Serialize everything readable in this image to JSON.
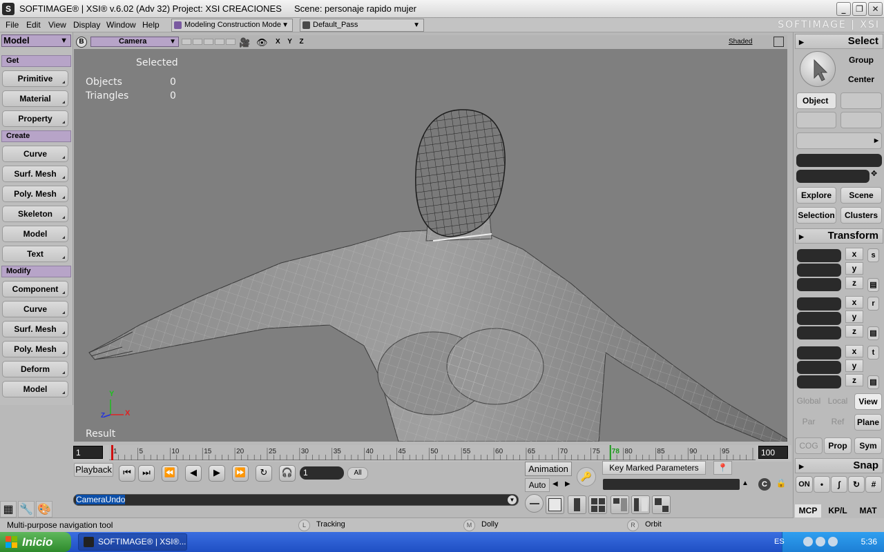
{
  "titlebar": {
    "icon": "S",
    "title": "SOFTIMAGE® | XSI® v.6.02 (Adv 32) Project: XSI CREACIONES     Scene: personaje rapido mujer",
    "minimize": "_",
    "maximize": "❐",
    "close": "✕"
  },
  "menubar": {
    "items": [
      "File",
      "Edit",
      "View",
      "Display",
      "Window",
      "Help"
    ],
    "mode_combo": "Modeling Construction Mode",
    "pass_combo": "Default_Pass",
    "brand": "SOFTIMAGE | XSI"
  },
  "leftpanel": {
    "module": "Model",
    "sections": [
      {
        "label": "Get",
        "buttons": [
          "Primitive",
          "Material",
          "Property"
        ]
      },
      {
        "label": "Create",
        "buttons": [
          "Curve",
          "Surf. Mesh",
          "Poly. Mesh",
          "Skeleton",
          "Model",
          "Text"
        ]
      },
      {
        "label": "Modify",
        "buttons": [
          "Component",
          "Curve",
          "Surf. Mesh",
          "Poly. Mesh",
          "Deform",
          "Model"
        ]
      }
    ]
  },
  "viewport": {
    "b_label": "B",
    "camera": "Camera",
    "axes": "X Y Z",
    "shading": "Shaded",
    "stats_header": "Selected",
    "objects_label": "Objects",
    "objects_value": "0",
    "triangles_label": "Triangles",
    "triangles_value": "0",
    "result_label": "Result",
    "axis_y": "Y",
    "axis_x": "X",
    "axis_z": "Z"
  },
  "timeline": {
    "start": "1",
    "end": "100",
    "current": "78",
    "ticks": [
      "1",
      "5",
      "10",
      "15",
      "20",
      "25",
      "30",
      "35",
      "40",
      "45",
      "50",
      "55",
      "60",
      "65",
      "70",
      "75",
      "80",
      "85",
      "90",
      "95"
    ]
  },
  "playback": {
    "label": "Playback",
    "frame_value": "1",
    "all": "All",
    "animation": "Animation",
    "auto": "Auto",
    "key_marked": "Key Marked Parameters"
  },
  "command": {
    "value": "CameraUndo"
  },
  "status": {
    "hint": "Multi-purpose navigation tool",
    "left_key": "L",
    "left_label": "Tracking",
    "mid_key": "M",
    "mid_label": "Dolly",
    "right_key": "R",
    "right_label": "Orbit"
  },
  "rightpanel": {
    "select_header": "Select",
    "group": "Group",
    "center": "Center",
    "object": "Object",
    "explore": "Explore",
    "scene": "Scene",
    "selection": "Selection",
    "clusters": "Clusters",
    "transform_header": "Transform",
    "x": "x",
    "y": "y",
    "z": "z",
    "s": "s",
    "r": "r",
    "t": "t",
    "global": "Global",
    "local": "Local",
    "view": "View",
    "par": "Par",
    "ref": "Ref",
    "plane": "Plane",
    "cog": "COG",
    "prop": "Prop",
    "sym": "Sym",
    "snap_header": "Snap",
    "on": "ON",
    "tab_mcp": "MCP",
    "tab_kpl": "KP/L",
    "tab_mat": "MAT"
  },
  "taskbar": {
    "start": "Inicio",
    "task": "SOFTIMAGE® | XSI®...",
    "lang": "ES",
    "time": "5:36"
  }
}
